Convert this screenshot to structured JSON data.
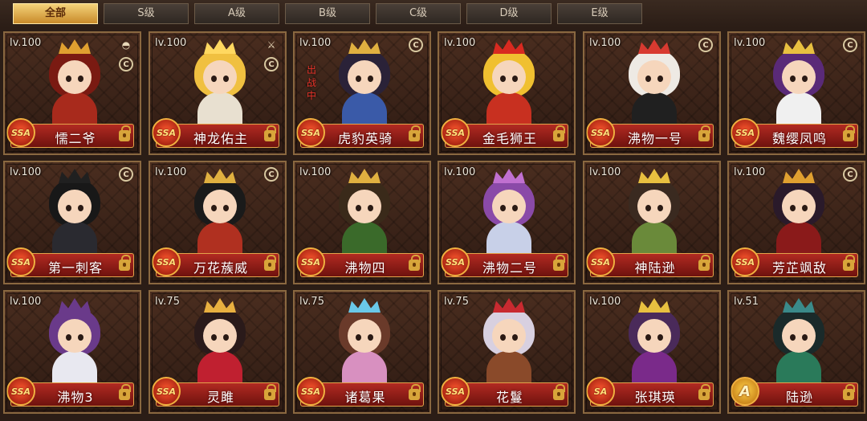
{
  "tabs": [
    {
      "label": "全部",
      "active": true
    },
    {
      "label": "S级",
      "active": false
    },
    {
      "label": "A级",
      "active": false
    },
    {
      "label": "B级",
      "active": false
    },
    {
      "label": "C级",
      "active": false
    },
    {
      "label": "D级",
      "active": false
    },
    {
      "label": "E级",
      "active": false
    }
  ],
  "heroes": [
    {
      "level": "lv.100",
      "name": "懦二爷",
      "rank": "SSA",
      "badges": [
        "ingot-icon",
        "coin-icon"
      ],
      "deployed": "",
      "colors": {
        "hair": "#7a1a12",
        "crown": "#e0a030",
        "body": "#a82a1c"
      }
    },
    {
      "level": "lv.100",
      "name": "神龙佑主",
      "rank": "SSA",
      "badges": [
        "sword-icon",
        "coin-icon"
      ],
      "deployed": "",
      "colors": {
        "hair": "#f0c040",
        "crown": "#ffd860",
        "body": "#e8e0d0"
      }
    },
    {
      "level": "lv.100",
      "name": "虎豹英骑",
      "rank": "SSA",
      "badges": [
        "coin-icon"
      ],
      "deployed": "出战中",
      "colors": {
        "hair": "#2a2238",
        "crown": "#e0b040",
        "body": "#3a5aa8"
      }
    },
    {
      "level": "lv.100",
      "name": "金毛狮王",
      "rank": "SSA",
      "badges": [],
      "deployed": "",
      "colors": {
        "hair": "#f0c030",
        "crown": "#d82a20",
        "body": "#c83020"
      }
    },
    {
      "level": "lv.100",
      "name": "沸物一号",
      "rank": "SSA",
      "badges": [
        "coin-icon"
      ],
      "deployed": "",
      "colors": {
        "hair": "#eeeae4",
        "crown": "#d83a30",
        "body": "#202020"
      }
    },
    {
      "level": "lv.100",
      "name": "魏缨凤鸣",
      "rank": "SSA",
      "badges": [
        "coin-icon"
      ],
      "deployed": "",
      "colors": {
        "hair": "#5a2a78",
        "crown": "#e8c040",
        "body": "#f0f0f0"
      }
    },
    {
      "level": "lv.100",
      "name": "第一刺客",
      "rank": "SSA",
      "badges": [
        "coin-icon"
      ],
      "deployed": "",
      "colors": {
        "hair": "#181818",
        "crown": "#202020",
        "body": "#2a2a30"
      }
    },
    {
      "level": "lv.100",
      "name": "万花蔟威",
      "rank": "SSA",
      "badges": [
        "coin-icon"
      ],
      "deployed": "",
      "colors": {
        "hair": "#1a1a1a",
        "crown": "#e0b040",
        "body": "#b03020"
      }
    },
    {
      "level": "lv.100",
      "name": "沸物四",
      "rank": "SSA",
      "badges": [],
      "deployed": "",
      "colors": {
        "hair": "#3a2a1a",
        "crown": "#e0b040",
        "body": "#3a6a2a"
      }
    },
    {
      "level": "lv.100",
      "name": "沸物二号",
      "rank": "SSA",
      "badges": [],
      "deployed": "",
      "colors": {
        "hair": "#8a4aa8",
        "crown": "#c070d0",
        "body": "#c8d0e8"
      }
    },
    {
      "level": "lv.100",
      "name": "神陆逊",
      "rank": "SSA",
      "badges": [],
      "deployed": "",
      "colors": {
        "hair": "#3a2a20",
        "crown": "#e8c040",
        "body": "#6a8a3a"
      }
    },
    {
      "level": "lv.100",
      "name": "芳芷飒敌",
      "rank": "SSA",
      "badges": [
        "coin-icon"
      ],
      "deployed": "",
      "colors": {
        "hair": "#2a1a2a",
        "crown": "#e0a030",
        "body": "#8a1a1a"
      }
    },
    {
      "level": "lv.100",
      "name": "沸物3",
      "rank": "SSA",
      "badges": [],
      "deployed": "",
      "colors": {
        "hair": "#6a3a8a",
        "crown": "#6a3a8a",
        "body": "#e8e8f0"
      }
    },
    {
      "level": "lv.75",
      "name": "灵雎",
      "rank": "SSA",
      "badges": [],
      "deployed": "",
      "colors": {
        "hair": "#2a1a1a",
        "crown": "#e8b040",
        "body": "#c02030"
      }
    },
    {
      "level": "lv.75",
      "name": "诸葛果",
      "rank": "SSA",
      "badges": [],
      "deployed": "",
      "colors": {
        "hair": "#6a3a2a",
        "crown": "#6ac8e8",
        "body": "#d890c0"
      }
    },
    {
      "level": "lv.75",
      "name": "花鬘",
      "rank": "SSA",
      "badges": [],
      "deployed": "",
      "colors": {
        "hair": "#d8d0e0",
        "crown": "#c82a30",
        "body": "#8a4a2a"
      }
    },
    {
      "level": "lv.100",
      "name": "张琪瑛",
      "rank": "SA",
      "badges": [],
      "deployed": "",
      "colors": {
        "hair": "#4a2a5a",
        "crown": "#e8c040",
        "body": "#7a2a8a"
      }
    },
    {
      "level": "lv.51",
      "name": "陆逊",
      "rank": "A",
      "badges": [],
      "deployed": "",
      "colors": {
        "hair": "#1a2a2a",
        "crown": "#3a8a8a",
        "body": "#2a7a5a"
      }
    }
  ]
}
